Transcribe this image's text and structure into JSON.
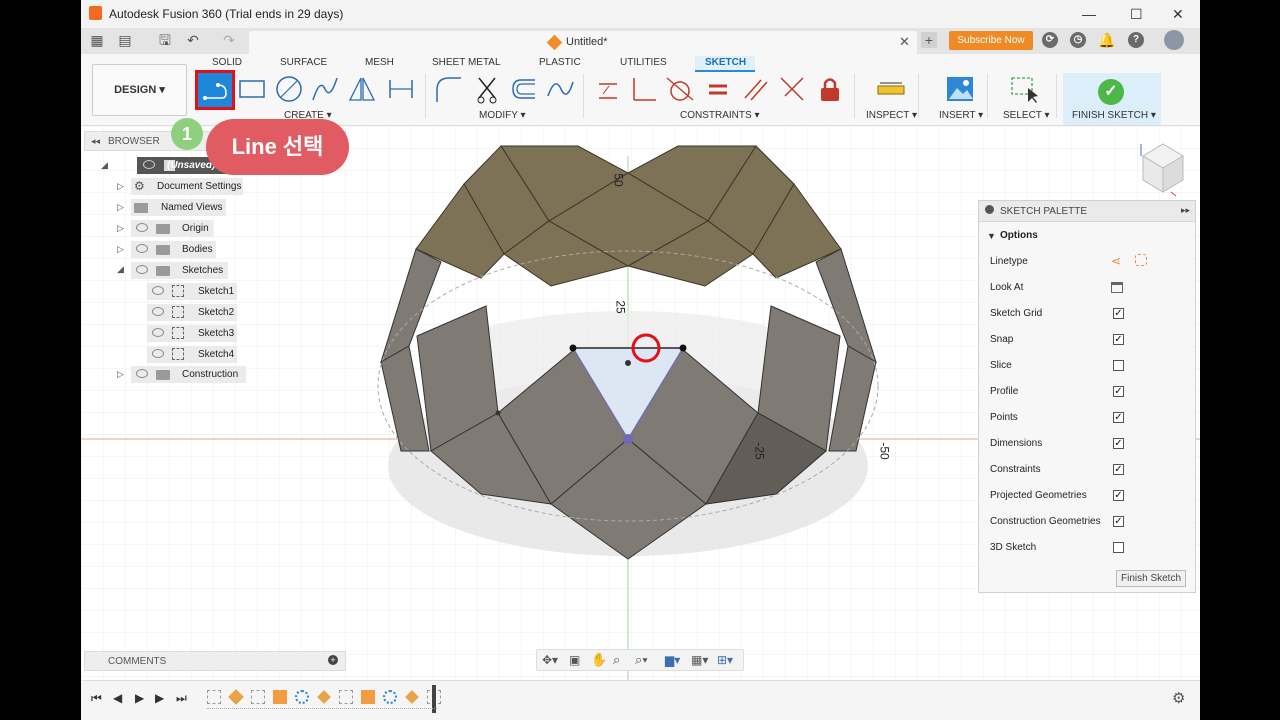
{
  "window": {
    "title": "Autodesk Fusion 360 (Trial ends in 29 days)",
    "controls": [
      "—",
      "☐",
      "✕"
    ]
  },
  "quickbar": {
    "document_tab": "Untitled*",
    "close": "✕",
    "new_tab": "+",
    "subscribe": "Subscribe Now"
  },
  "ribbon": {
    "workspace": "DESIGN ▾",
    "tabs": [
      "SOLID",
      "SURFACE",
      "MESH",
      "SHEET METAL",
      "PLASTIC",
      "UTILITIES",
      "SKETCH"
    ],
    "active_tab": "SKETCH",
    "groups": {
      "create": "CREATE ▾",
      "modify": "MODIFY ▾",
      "constraints": "CONSTRAINTS ▾",
      "inspect": "INSPECT ▾",
      "insert": "INSERT ▾",
      "select": "SELECT ▾",
      "finish": "FINISH SKETCH ▾"
    }
  },
  "callout": {
    "step": "1",
    "text": "Line 선택"
  },
  "browser": {
    "title": "BROWSER",
    "root": "(Unsaved)",
    "items": [
      {
        "label": "Document Settings"
      },
      {
        "label": "Named Views"
      },
      {
        "label": "Origin"
      },
      {
        "label": "Bodies"
      },
      {
        "label": "Sketches"
      },
      {
        "label": "Sketch1"
      },
      {
        "label": "Sketch2"
      },
      {
        "label": "Sketch3"
      },
      {
        "label": "Sketch4"
      },
      {
        "label": "Construction"
      }
    ]
  },
  "viewport": {
    "dims": {
      "top": "50",
      "mid": "25",
      "right_near": "-25",
      "right_far": "-50"
    }
  },
  "palette": {
    "title": "SKETCH PALETTE",
    "section": "Options",
    "rows": [
      {
        "label": "Linetype",
        "kind": "icons"
      },
      {
        "label": "Look At",
        "kind": "icon"
      },
      {
        "label": "Sketch Grid",
        "checked": true
      },
      {
        "label": "Snap",
        "checked": true
      },
      {
        "label": "Slice",
        "checked": false
      },
      {
        "label": "Profile",
        "checked": true
      },
      {
        "label": "Points",
        "checked": true
      },
      {
        "label": "Dimensions",
        "checked": true
      },
      {
        "label": "Constraints",
        "checked": true
      },
      {
        "label": "Projected Geometries",
        "checked": true
      },
      {
        "label": "Construction Geometries",
        "checked": true
      },
      {
        "label": "3D Sketch",
        "checked": false
      }
    ],
    "finish_button": "Finish Sketch"
  },
  "comments": {
    "title": "COMMENTS"
  },
  "colors": {
    "accent": "#1f87d8",
    "highlight": "#e3101a",
    "callout": "#e05b62",
    "step": "#8ed07d",
    "subscribe": "#f08a24"
  }
}
